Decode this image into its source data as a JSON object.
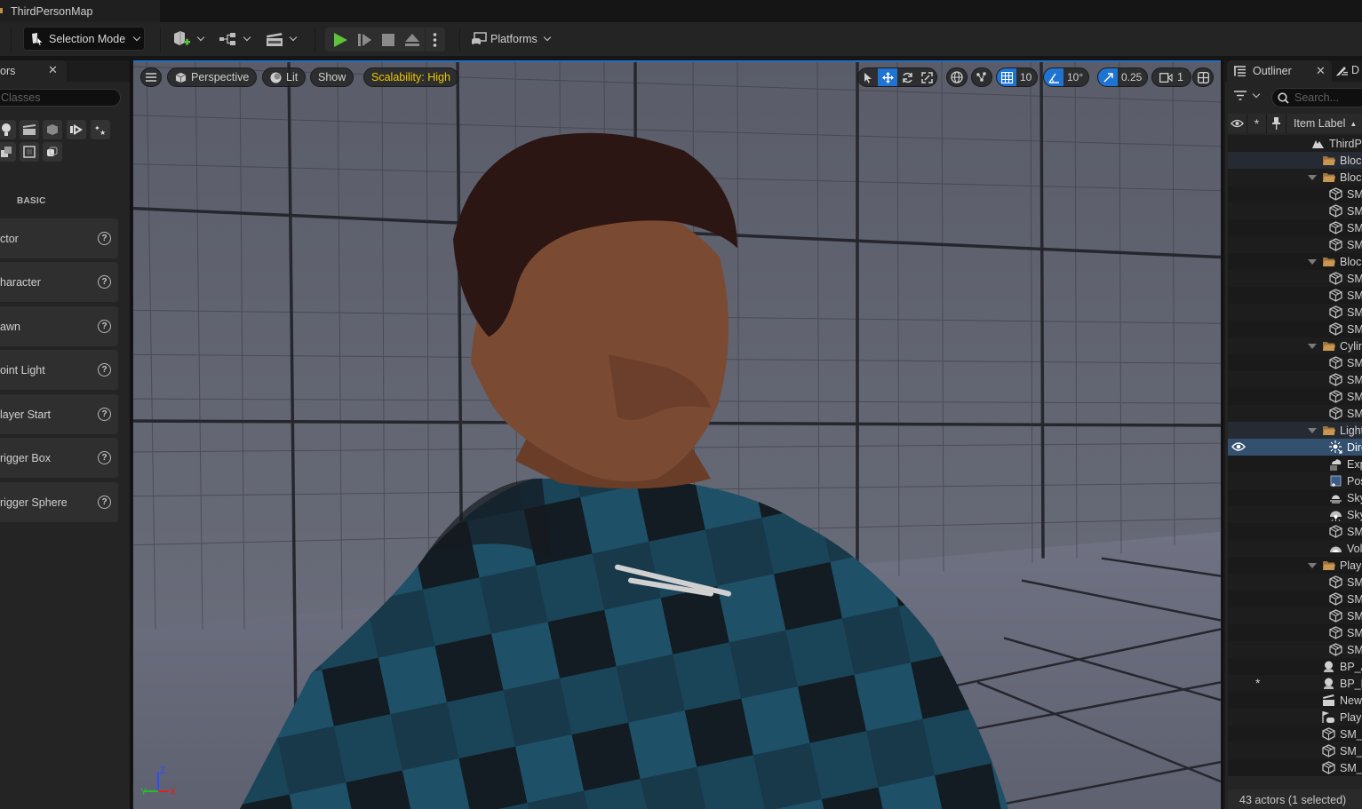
{
  "window": {
    "map_tab_title": "ThirdPersonMap"
  },
  "toolbar": {
    "mode_label": "Selection Mode",
    "platforms_label": "Platforms",
    "buttons": [
      "add-content",
      "blueprints",
      "cinematics",
      "play",
      "advance-frame",
      "stop",
      "eject",
      "more-options"
    ]
  },
  "left_panel": {
    "tab_label": "ors",
    "search_placeholder": "Classes",
    "category_icons": [
      "light-bulb",
      "cinematic-clapper",
      "visual-effects-cube",
      "media",
      "effects-stars",
      "volumes",
      "all-classes",
      "shapes"
    ],
    "section_label": "BASIC",
    "items": [
      {
        "label": "ctor"
      },
      {
        "label": "haracter"
      },
      {
        "label": "awn"
      },
      {
        "label": "oint Light"
      },
      {
        "label": "layer Start"
      },
      {
        "label": "rigger Box"
      },
      {
        "label": "rigger Sphere"
      }
    ]
  },
  "viewport": {
    "perspective_label": "Perspective",
    "view_mode_label": "Lit",
    "show_label": "Show",
    "scalability_label": "Scalability: High",
    "grid_snap_value": "10",
    "rotation_snap_value": "10°",
    "scale_snap_value": "0.25",
    "camera_speed_value": "1",
    "axis_labels": {
      "x": "X",
      "y": "Y",
      "z": "Z"
    },
    "accent_color": "#1f73d1",
    "scalability_color": "#f0c800"
  },
  "outliner": {
    "tab_label": "Outliner",
    "second_tab_label": "D",
    "search_placeholder": "Search...",
    "column_header": "Item Label",
    "rows": [
      {
        "label": "ThirdPe",
        "type": "world",
        "indent": 0
      },
      {
        "label": "Block",
        "type": "folder-collapsed",
        "indent": 1
      },
      {
        "label": "Block",
        "type": "folder",
        "indent": 1
      },
      {
        "label": "SM_",
        "type": "mesh",
        "indent": 2
      },
      {
        "label": "SM_",
        "type": "mesh",
        "indent": 2
      },
      {
        "label": "SM_",
        "type": "mesh",
        "indent": 2
      },
      {
        "label": "SM_",
        "type": "mesh",
        "indent": 2
      },
      {
        "label": "Block",
        "type": "folder",
        "indent": 1
      },
      {
        "label": "SM_",
        "type": "mesh",
        "indent": 2
      },
      {
        "label": "SM_",
        "type": "mesh",
        "indent": 2
      },
      {
        "label": "SM_",
        "type": "mesh",
        "indent": 2
      },
      {
        "label": "SM_",
        "type": "mesh",
        "indent": 2
      },
      {
        "label": "Cylinc",
        "type": "folder",
        "indent": 1
      },
      {
        "label": "SM_",
        "type": "mesh",
        "indent": 2
      },
      {
        "label": "SM_",
        "type": "mesh",
        "indent": 2
      },
      {
        "label": "SM_",
        "type": "mesh",
        "indent": 2
      },
      {
        "label": "SM_",
        "type": "mesh",
        "indent": 2
      },
      {
        "label": "Lightin",
        "type": "folder",
        "indent": 1
      },
      {
        "label": "Dire",
        "type": "directional-light",
        "indent": 2,
        "selected": true
      },
      {
        "label": "Exp",
        "type": "exponential-fog",
        "indent": 2
      },
      {
        "label": "Pos",
        "type": "post-process",
        "indent": 2
      },
      {
        "label": "Sky",
        "type": "sky-atmosphere",
        "indent": 2
      },
      {
        "label": "Sky",
        "type": "sky-light",
        "indent": 2
      },
      {
        "label": "SM_",
        "type": "mesh",
        "indent": 2
      },
      {
        "label": "Volu",
        "type": "volumetric-cloud",
        "indent": 2
      },
      {
        "label": "Playg",
        "type": "folder",
        "indent": 1
      },
      {
        "label": "SM_",
        "type": "mesh",
        "indent": 2
      },
      {
        "label": "SM_",
        "type": "mesh",
        "indent": 2
      },
      {
        "label": "SM_",
        "type": "mesh",
        "indent": 2
      },
      {
        "label": "SM_",
        "type": "mesh",
        "indent": 2
      },
      {
        "label": "SM_",
        "type": "mesh",
        "indent": 2
      },
      {
        "label": "BP_Ac",
        "type": "blueprint",
        "indent": 1
      },
      {
        "label": "BP_Da",
        "type": "blueprint",
        "indent": 1,
        "starred": true
      },
      {
        "label": "NewL",
        "type": "level-sequence",
        "indent": 1
      },
      {
        "label": "Player",
        "type": "player-start",
        "indent": 1
      },
      {
        "label": "SM_C",
        "type": "mesh",
        "indent": 1
      },
      {
        "label": "SM_C",
        "type": "mesh",
        "indent": 1
      },
      {
        "label": "SM_C",
        "type": "mesh",
        "indent": 1
      }
    ],
    "status": "43 actors (1 selected)"
  }
}
